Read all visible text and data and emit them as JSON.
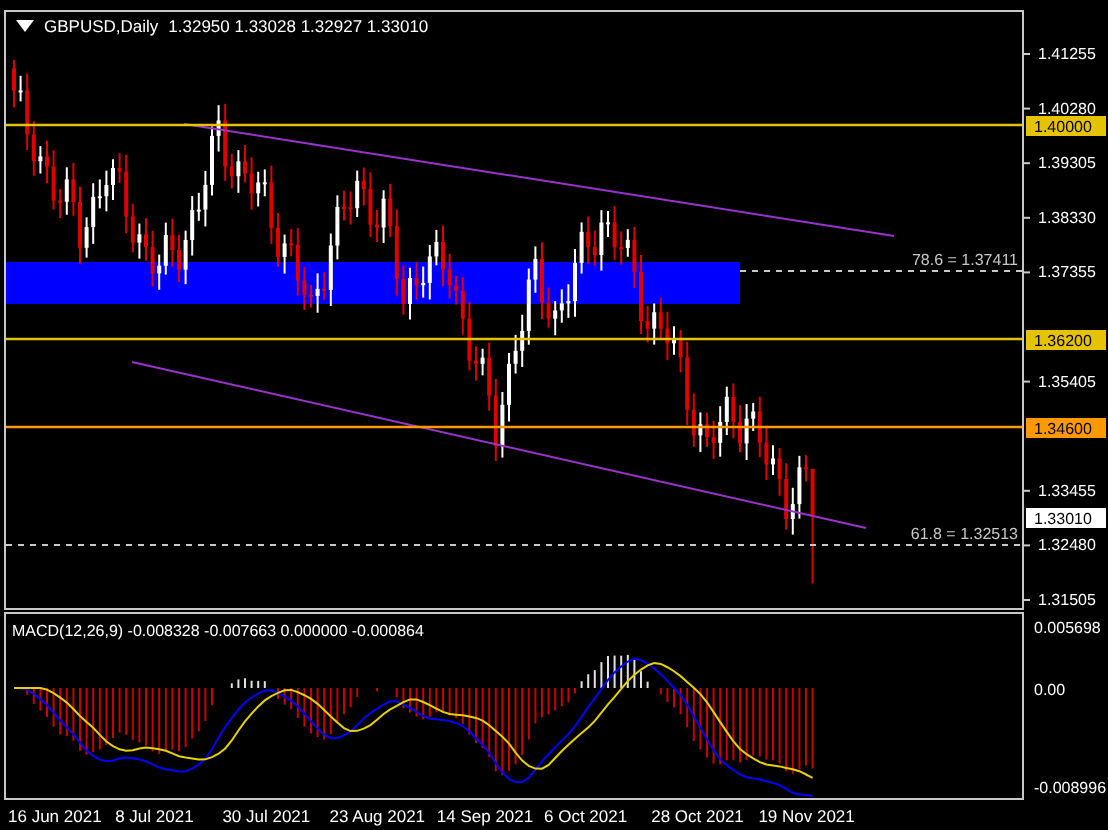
{
  "header": {
    "symbol": "GBPUSD,Daily",
    "ohlc": "1.32950 1.33028 1.32927 1.33010"
  },
  "price_axis": {
    "ticks": [
      "1.41255",
      "1.40280",
      "1.39305",
      "1.38330",
      "1.37355",
      "1.35405",
      "1.33455",
      "1.32480",
      "1.31505"
    ]
  },
  "price_levels": [
    {
      "kind": "level",
      "label": "1.40000",
      "color": "#e6c300"
    },
    {
      "kind": "level",
      "label": "1.36200",
      "color": "#e6c300"
    },
    {
      "kind": "level",
      "label": "1.34600",
      "color": "#ff9900"
    },
    {
      "kind": "current",
      "label": "1.33010",
      "color": "#ffffff"
    }
  ],
  "fib_levels": [
    {
      "label": "78.6 = 1.37411"
    },
    {
      "label": "61.8 = 1.32513"
    }
  ],
  "macd": {
    "label": "MACD(12,26,9) -0.008328 -0.007663 0.000000 -0.000864",
    "axis": [
      "0.005698",
      "0.00",
      "-0.008996"
    ]
  },
  "date_axis": [
    "16 Jun 2021",
    "8 Jul 2021",
    "30 Jul 2021",
    "23 Aug 2021",
    "14 Sep 2021",
    "6 Oct 2021",
    "28 Oct 2021",
    "19 Nov 2021"
  ]
}
